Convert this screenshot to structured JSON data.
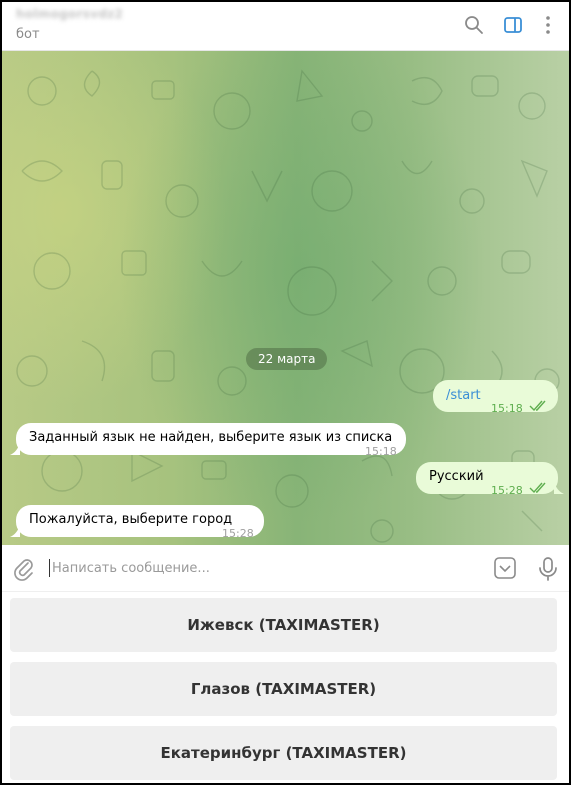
{
  "header": {
    "chat_name": "holmogorsvdz2",
    "chat_subtitle": "бот",
    "icons": [
      "search-icon",
      "sidebar-toggle-icon",
      "more-vertical-icon"
    ]
  },
  "chat": {
    "date_separator": "22 марта",
    "messages": [
      {
        "direction": "out",
        "text": "/start",
        "time": "15:18",
        "status": "read"
      },
      {
        "direction": "in",
        "text": "Заданный язык не найден, выберите язык из списка",
        "time": "15:18"
      },
      {
        "direction": "out",
        "text": "Русский",
        "time": "15:28",
        "status": "read"
      },
      {
        "direction": "in",
        "text": "Пожалуйста, выберите город",
        "time": "15:28"
      }
    ]
  },
  "composer": {
    "placeholder": "Написать сообщение...",
    "value": "",
    "icons": [
      "attach-icon",
      "keyboard-toggle-icon",
      "microphone-icon"
    ]
  },
  "keyboard": {
    "buttons": [
      {
        "label": "Ижевск (TAXIMASTER)"
      },
      {
        "label": "Глазов (TAXIMASTER)"
      },
      {
        "label": "Екатеринбург (TAXIMASTER)"
      }
    ]
  },
  "colors": {
    "accent": "#3a8fd6",
    "outgoing_bubble": "#e9fbd8",
    "incoming_bubble": "#ffffff",
    "read_ticks": "#5fae4f"
  }
}
